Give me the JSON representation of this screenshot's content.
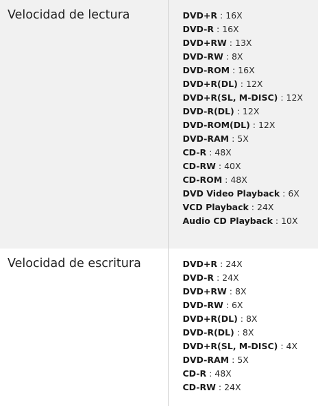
{
  "specs": [
    {
      "label": "Velocidad de lectura",
      "items": [
        {
          "format": "DVD+R",
          "speed": "16X"
        },
        {
          "format": "DVD-R",
          "speed": "16X"
        },
        {
          "format": "DVD+RW",
          "speed": "13X"
        },
        {
          "format": "DVD-RW",
          "speed": "8X"
        },
        {
          "format": "DVD-ROM",
          "speed": "16X"
        },
        {
          "format": "DVD+R(DL)",
          "speed": "12X"
        },
        {
          "format": "DVD+R(SL, M-DISC)",
          "speed": "12X"
        },
        {
          "format": "DVD-R(DL)",
          "speed": "12X"
        },
        {
          "format": "DVD-ROM(DL)",
          "speed": "12X"
        },
        {
          "format": "DVD-RAM",
          "speed": "5X"
        },
        {
          "format": "CD-R",
          "speed": "48X"
        },
        {
          "format": "CD-RW",
          "speed": "40X"
        },
        {
          "format": "CD-ROM",
          "speed": "48X"
        },
        {
          "format": "DVD Video Playback",
          "speed": "6X"
        },
        {
          "format": "VCD Playback",
          "speed": "24X"
        },
        {
          "format": "Audio CD Playback",
          "speed": "10X"
        }
      ]
    },
    {
      "label": "Velocidad de escritura",
      "items": [
        {
          "format": "DVD+R",
          "speed": "24X"
        },
        {
          "format": "DVD-R",
          "speed": "24X"
        },
        {
          "format": "DVD+RW",
          "speed": "8X"
        },
        {
          "format": "DVD-RW",
          "speed": "6X"
        },
        {
          "format": "DVD+R(DL)",
          "speed": "8X"
        },
        {
          "format": "DVD-R(DL)",
          "speed": "8X"
        },
        {
          "format": "DVD+R(SL, M-DISC)",
          "speed": "4X"
        },
        {
          "format": "DVD-RAM",
          "speed": "5X"
        },
        {
          "format": "CD-R",
          "speed": "48X"
        },
        {
          "format": "CD-RW",
          "speed": "24X"
        }
      ]
    }
  ]
}
